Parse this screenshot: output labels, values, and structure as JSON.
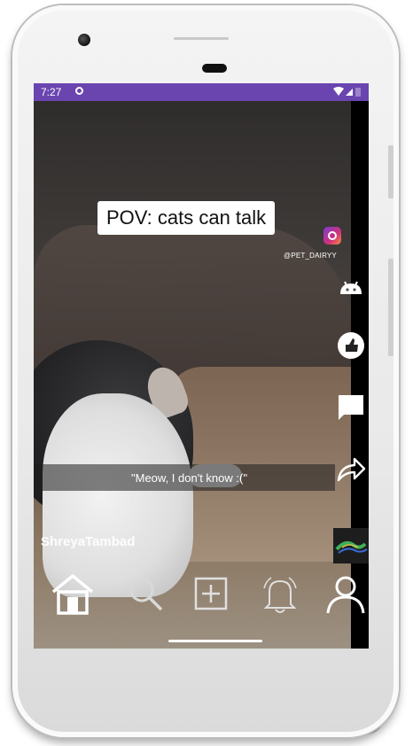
{
  "status_bar": {
    "time": "7:27",
    "color": "#6a45b0"
  },
  "video": {
    "caption": "POV: cats can talk",
    "watermark_handle": "@PET_DAIRYY",
    "subtitle": "\"Meow, I don't know :(\"",
    "username": "ShreyaTambad"
  },
  "side_actions": [
    {
      "icon": "android-icon"
    },
    {
      "icon": "like-icon"
    },
    {
      "icon": "comment-icon"
    },
    {
      "icon": "share-icon"
    }
  ],
  "bottom_nav": [
    {
      "icon": "home-icon",
      "active": true
    },
    {
      "icon": "search-icon"
    },
    {
      "icon": "add-post-icon"
    },
    {
      "icon": "notifications-bell-icon"
    },
    {
      "icon": "profile-icon"
    }
  ]
}
